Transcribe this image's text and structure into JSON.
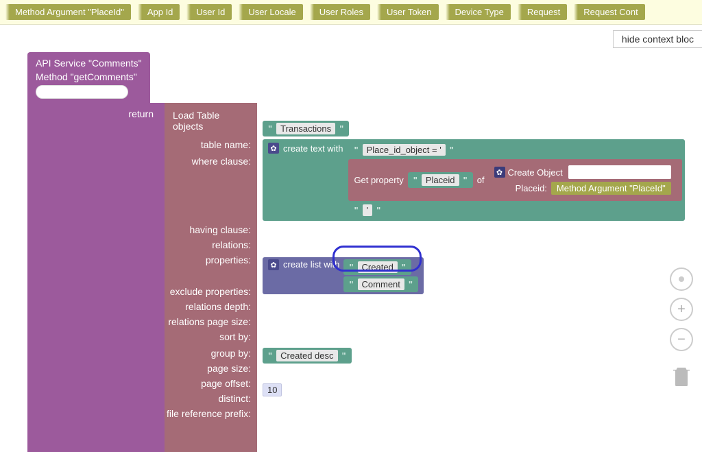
{
  "contextChips": [
    "Method Argument \"PlaceId\"",
    "App Id",
    "User Id",
    "User Locale",
    "User Roles",
    "User Token",
    "Device Type",
    "Request",
    "Request Cont"
  ],
  "hideContextLabel": "hide context bloc",
  "apiService": {
    "line1": "API Service \"Comments\"",
    "line2": "Method \"getComments\""
  },
  "returnLabel": "return",
  "loadTable": {
    "title": "Load Table objects",
    "fields": {
      "tableName": "table name:",
      "whereClause": "where clause:",
      "havingClause": "having clause:",
      "relations": "relations:",
      "properties": "properties:",
      "excludeProperties": "exclude properties:",
      "relationsDepth": "relations depth:",
      "relationsPageSize": "relations page size:",
      "sortBy": "sort by:",
      "groupBy": "group by:",
      "pageSize": "page size:",
      "pageOffset": "page offset:",
      "distinct": "distinct:",
      "fileRefPrefix": "file reference prefix:"
    }
  },
  "values": {
    "tableName": "Transactions",
    "createTextWith": "create text with",
    "placeIdObjectEq": "Place_id_object = '",
    "getProperty": "Get property",
    "placeidLabel": "Placeid",
    "ofLabel": "of",
    "createObject": "Create Object",
    "placeidField": "Placeid:",
    "methodArgPlaceId": "Method Argument \"PlaceId\"",
    "closingQuote": "'",
    "createListWith": "create list with",
    "created": "Created",
    "comment": "Comment",
    "createdDesc": "Created desc",
    "pageSizeVal": "10"
  },
  "sideControls": {
    "center": "center",
    "zoomIn": "+",
    "zoomOut": "−",
    "trash": "trash"
  }
}
